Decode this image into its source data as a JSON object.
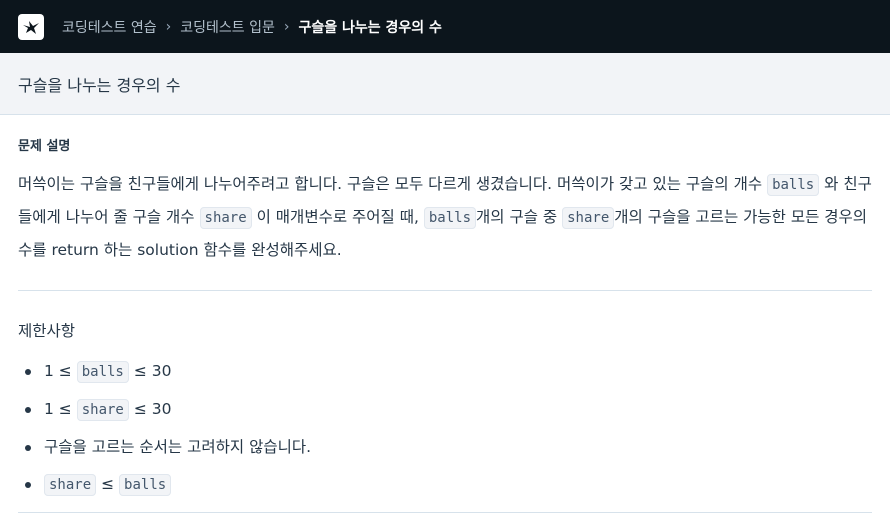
{
  "header": {
    "logo_icon": "programmers-logo-icon",
    "breadcrumb": [
      "코딩테스트 연습",
      "코딩테스트 입문",
      "구슬을 나누는 경우의 수"
    ]
  },
  "title": "구슬을 나누는 경우의 수",
  "description": {
    "heading": "문제 설명",
    "p1": "머쓱이는 구슬을 친구들에게 나누어주려고 합니다. 구슬은 모두 다르게 생겼습니다. 머쓱이가 갖고 있는 구슬의 개수",
    "code_balls": "balls",
    "p2": "와 친구들에게 나누어 줄 구슬 개수",
    "code_share": "share",
    "p3": "이 매개변수로 주어질 때,",
    "p4": "개의 구슬 중",
    "p5": "개의 구슬을 고르는 가능한 모든 경우의 수를 return 하는 solution 함수를 완성해주세요."
  },
  "constraints": {
    "heading": "제한사항",
    "c1_pre": "1 ≤",
    "c1_code": "balls",
    "c1_post": "≤ 30",
    "c2_pre": "1 ≤",
    "c2_code": "share",
    "c2_post": "≤ 30",
    "c3": "구슬을 고르는 순서는 고려하지 않습니다.",
    "c4_code_a": "share",
    "c4_op": "≤",
    "c4_code_b": "balls"
  }
}
